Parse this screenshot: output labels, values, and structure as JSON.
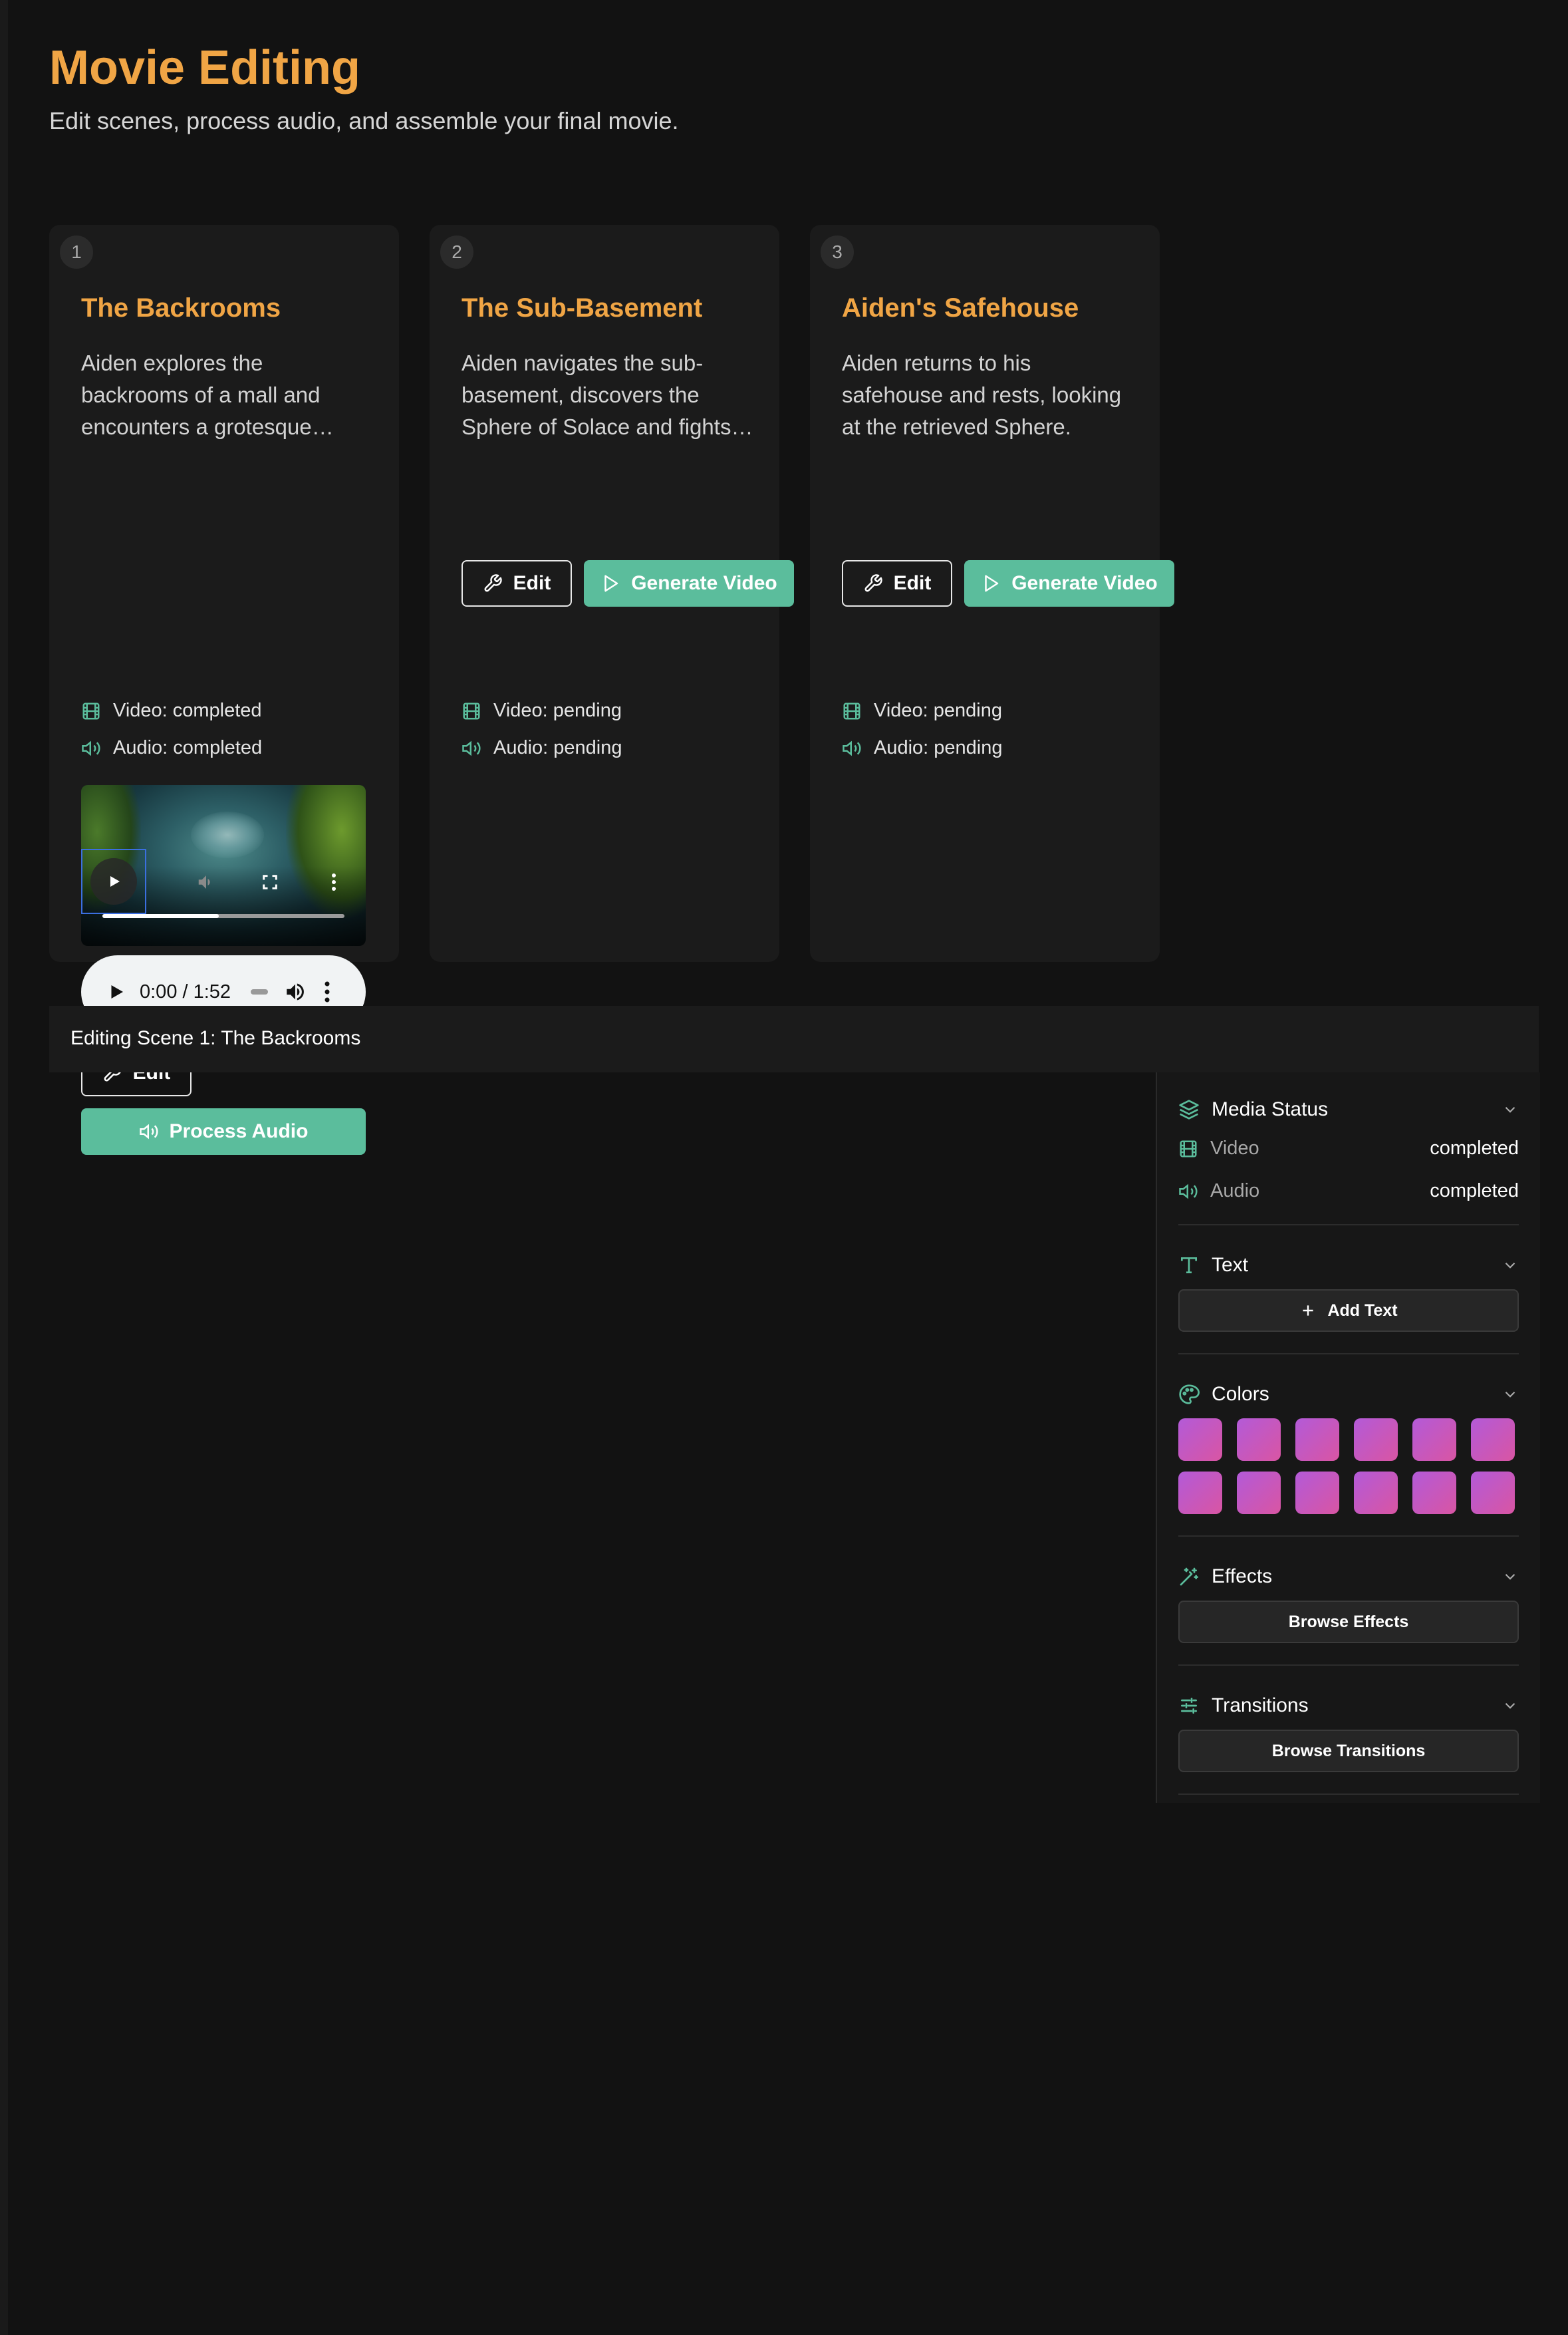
{
  "header": {
    "title": "Movie Editing",
    "subtitle": "Edit scenes, process audio, and assemble your final movie."
  },
  "scenes": [
    {
      "number": "1",
      "title": "The Backrooms",
      "description": "Aiden explores the backrooms of a mall and encounters a grotesque creature.",
      "video_status": "Video: completed",
      "audio_status": "Audio: completed",
      "audio_time": "0:00 / 1:52",
      "video_progress": 0.48,
      "edit_label": "Edit",
      "action_label": "Process Audio"
    },
    {
      "number": "2",
      "title": "The Sub-Basement",
      "description": "Aiden navigates the sub-basement, discovers the Sphere of Solace and fights the creature.",
      "video_status": "Video: pending",
      "audio_status": "Audio: pending",
      "edit_label": "Edit",
      "action_label": "Generate Video"
    },
    {
      "number": "3",
      "title": "Aiden's Safehouse",
      "description": "Aiden returns to his safehouse and rests, looking at the retrieved Sphere.",
      "video_status": "Video: pending",
      "audio_status": "Audio: pending",
      "edit_label": "Edit",
      "action_label": "Generate Video"
    }
  ],
  "editor": {
    "label": "Editing Scene 1: The Backrooms",
    "sidebar": {
      "media_status": {
        "title": "Media Status",
        "video_label": "Video",
        "video_value": "completed",
        "audio_label": "Audio",
        "audio_value": "completed"
      },
      "text": {
        "title": "Text",
        "button": "Add Text"
      },
      "colors": {
        "title": "Colors",
        "swatch_count": 12,
        "swatch_gradient": [
          "#b35ad8",
          "#d955a3"
        ]
      },
      "effects": {
        "title": "Effects",
        "button": "Browse Effects"
      },
      "transitions": {
        "title": "Transitions",
        "button": "Browse Transitions"
      }
    }
  },
  "colors": {
    "accent": "#f0a545",
    "teal": "#5bbd9c",
    "background": "#121212",
    "card": "#1b1b1b"
  },
  "icons": {
    "video": "film-icon",
    "audio": "speaker-icon",
    "edit": "wrench-icon",
    "generate": "play-icon",
    "media_status": "layers-icon",
    "text": "type-icon",
    "colors": "palette-icon",
    "effects": "magic-wand-icon",
    "transitions": "sliders-icon",
    "collapse": "chevron-down-icon"
  }
}
